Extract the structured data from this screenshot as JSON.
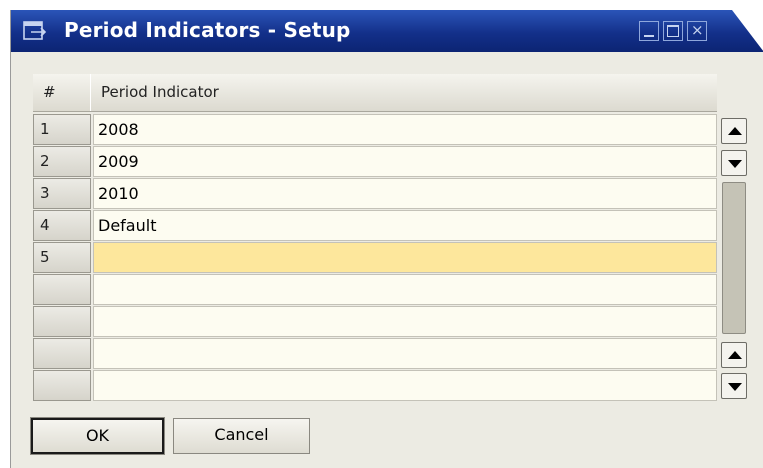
{
  "window": {
    "title": "Period Indicators - Setup",
    "title_icon": "form-icon",
    "controls": {
      "minimize": "minimize-icon",
      "maximize": "maximize-icon",
      "close": "×"
    }
  },
  "grid": {
    "columns": {
      "number": "#",
      "period_indicator": "Period Indicator"
    },
    "rows": [
      {
        "num": "1",
        "value": "2008"
      },
      {
        "num": "2",
        "value": "2009"
      },
      {
        "num": "3",
        "value": "2010"
      },
      {
        "num": "4",
        "value": "Default"
      },
      {
        "num": "5",
        "value": ""
      },
      {
        "num": "",
        "value": ""
      },
      {
        "num": "",
        "value": ""
      },
      {
        "num": "",
        "value": ""
      },
      {
        "num": "",
        "value": ""
      }
    ],
    "selected_row": 4
  },
  "buttons": {
    "ok": "OK",
    "cancel": "Cancel"
  },
  "colors": {
    "titlebar": "#13308a",
    "selected_row": "#fde79c",
    "cell_background": "#fdfcf1",
    "window_background": "#ecebe3"
  }
}
